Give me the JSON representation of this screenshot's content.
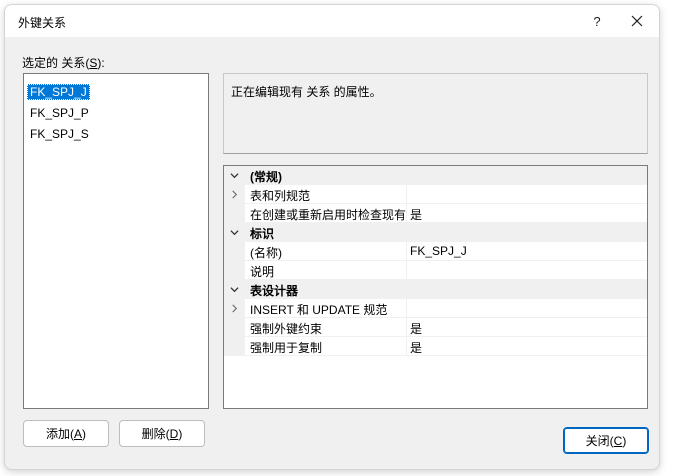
{
  "window": {
    "title": "外键关系",
    "help_label": "?"
  },
  "relations": {
    "label_prefix": "选定的 关系(",
    "label_key": "S",
    "label_suffix": "):",
    "items": [
      "FK_SPJ_J",
      "FK_SPJ_P",
      "FK_SPJ_S"
    ],
    "selected_index": 0
  },
  "info": {
    "text": "正在编辑现有 关系 的属性。"
  },
  "properties": [
    {
      "type": "category",
      "name": "(常规)",
      "expanded": true
    },
    {
      "type": "expandable",
      "name": "表和列规范",
      "value": ""
    },
    {
      "type": "prop",
      "name": "在创建或重新启用时检查现有",
      "value": "是"
    },
    {
      "type": "category",
      "name": "标识",
      "expanded": true
    },
    {
      "type": "prop",
      "name": "(名称)",
      "value": "FK_SPJ_J"
    },
    {
      "type": "prop",
      "name": "说明",
      "value": ""
    },
    {
      "type": "category",
      "name": "表设计器",
      "expanded": true
    },
    {
      "type": "expandable",
      "name": "INSERT 和 UPDATE 规范",
      "value": ""
    },
    {
      "type": "prop",
      "name": "强制外键约束",
      "value": "是"
    },
    {
      "type": "prop",
      "name": "强制用于复制",
      "value": "是"
    }
  ],
  "buttons": {
    "add": {
      "prefix": "添加(",
      "key": "A",
      "suffix": ")"
    },
    "delete": {
      "prefix": "删除(",
      "key": "D",
      "suffix": ")"
    },
    "close": {
      "prefix": "关闭(",
      "key": "C",
      "suffix": ")"
    }
  },
  "colors": {
    "selection": "#0078d7",
    "accent_border": "#0067c0",
    "dialog_bg": "#f0f0f0"
  }
}
